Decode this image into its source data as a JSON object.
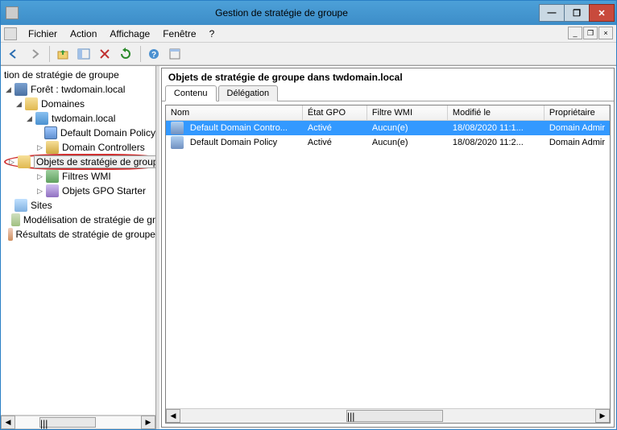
{
  "window": {
    "title": "Gestion de stratégie de groupe"
  },
  "menu": {
    "file": "Fichier",
    "action": "Action",
    "view": "Affichage",
    "window": "Fenêtre",
    "help": "?"
  },
  "tree": {
    "root": "tion de stratégie de groupe",
    "forest": "Forêt : twdomain.local",
    "domains": "Domaines",
    "domain": "twdomain.local",
    "defaultPolicy": "Default Domain Policy",
    "domainControllers": "Domain Controllers",
    "gpoObjects": "Objets de stratégie de groupe",
    "wmiFilters": "Filtres WMI",
    "starterGPO": "Objets GPO Starter",
    "sites": "Sites",
    "modeling": "Modélisation de stratégie de gr",
    "results": "Résultats de stratégie de groupe"
  },
  "right": {
    "heading": "Objets de stratégie de groupe dans twdomain.local",
    "tabs": {
      "content": "Contenu",
      "delegation": "Délégation"
    },
    "columns": {
      "name": "Nom",
      "gpoState": "État GPO",
      "wmiFilter": "Filtre WMI",
      "modified": "Modifié le",
      "owner": "Propriétaire"
    },
    "rows": [
      {
        "name": "Default Domain Contro...",
        "state": "Activé",
        "wmi": "Aucun(e)",
        "modified": "18/08/2020 11:1...",
        "owner": "Domain Admir"
      },
      {
        "name": "Default Domain Policy",
        "state": "Activé",
        "wmi": "Aucun(e)",
        "modified": "18/08/2020 11:2...",
        "owner": "Domain Admir"
      }
    ]
  },
  "thumbLabel": "|||"
}
